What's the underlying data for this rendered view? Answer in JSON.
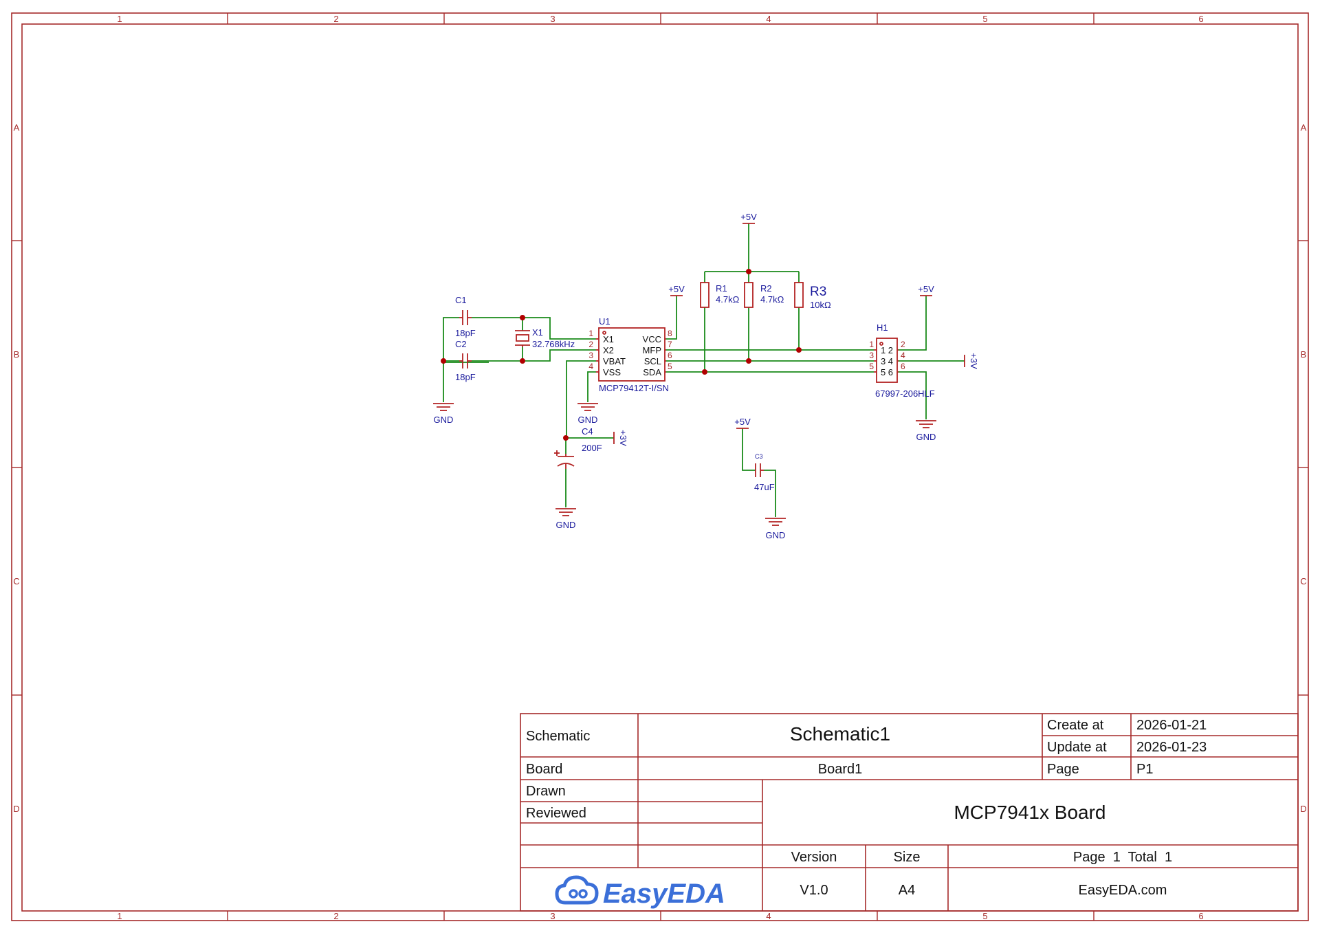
{
  "border": {
    "columns": [
      "1",
      "2",
      "3",
      "4",
      "5",
      "6"
    ],
    "rows": [
      "A",
      "B",
      "C",
      "D"
    ]
  },
  "schematic": {
    "power_5v": "+5V",
    "power_3v": "+3V",
    "gnd": "GND",
    "c1": {
      "ref": "C1",
      "value": "18pF"
    },
    "c2": {
      "ref": "C2",
      "value": "18pF"
    },
    "c3": {
      "ref": "C3",
      "value": "47uF"
    },
    "c4": {
      "ref": "C4",
      "value": "200F"
    },
    "x1": {
      "ref": "X1",
      "value": "32.768kHz"
    },
    "u1": {
      "ref": "U1",
      "part": "MCP79412T-I/SN",
      "pins_left": [
        {
          "num": "1",
          "name": "X1"
        },
        {
          "num": "2",
          "name": "X2"
        },
        {
          "num": "3",
          "name": "VBAT"
        },
        {
          "num": "4",
          "name": "VSS"
        }
      ],
      "pins_right": [
        {
          "num": "8",
          "name": "VCC"
        },
        {
          "num": "7",
          "name": "MFP"
        },
        {
          "num": "6",
          "name": "SCL"
        },
        {
          "num": "5",
          "name": "SDA"
        }
      ]
    },
    "r1": {
      "ref": "R1",
      "value": "4.7kΩ"
    },
    "r2": {
      "ref": "R2",
      "value": "4.7kΩ"
    },
    "r3": {
      "ref": "R3",
      "value": "10kΩ"
    },
    "h1": {
      "ref": "H1",
      "part": "67997-206HLF",
      "pins_left": [
        "1",
        "3",
        "5"
      ],
      "pins_right": [
        "2",
        "4",
        "6"
      ],
      "inner": [
        "1 2",
        "3 4",
        "5 6"
      ]
    }
  },
  "title_block": {
    "schematic_label": "Schematic",
    "schematic_value": "Schematic1",
    "create_label": "Create at",
    "create_value": "2026-01-21",
    "update_label": "Update at",
    "update_value": "2026-01-23",
    "board_label": "Board",
    "board_value": "Board1",
    "page_label": "Page",
    "page_value": "P1",
    "drawn_label": "Drawn",
    "reviewed_label": "Reviewed",
    "project_title": "MCP7941x Board",
    "version_label": "Version",
    "version_value": "V1.0",
    "size_label": "Size",
    "size_value": "A4",
    "page_total": "Page  1  Total  1",
    "website": "EasyEDA.com",
    "logo_text": "EasyEDA"
  },
  "colors": {
    "border": "#a52a2a",
    "wire": "#1a8a1a",
    "component": "#b22222",
    "label": "#1a1a9c",
    "logo": "#3b6fd8"
  }
}
